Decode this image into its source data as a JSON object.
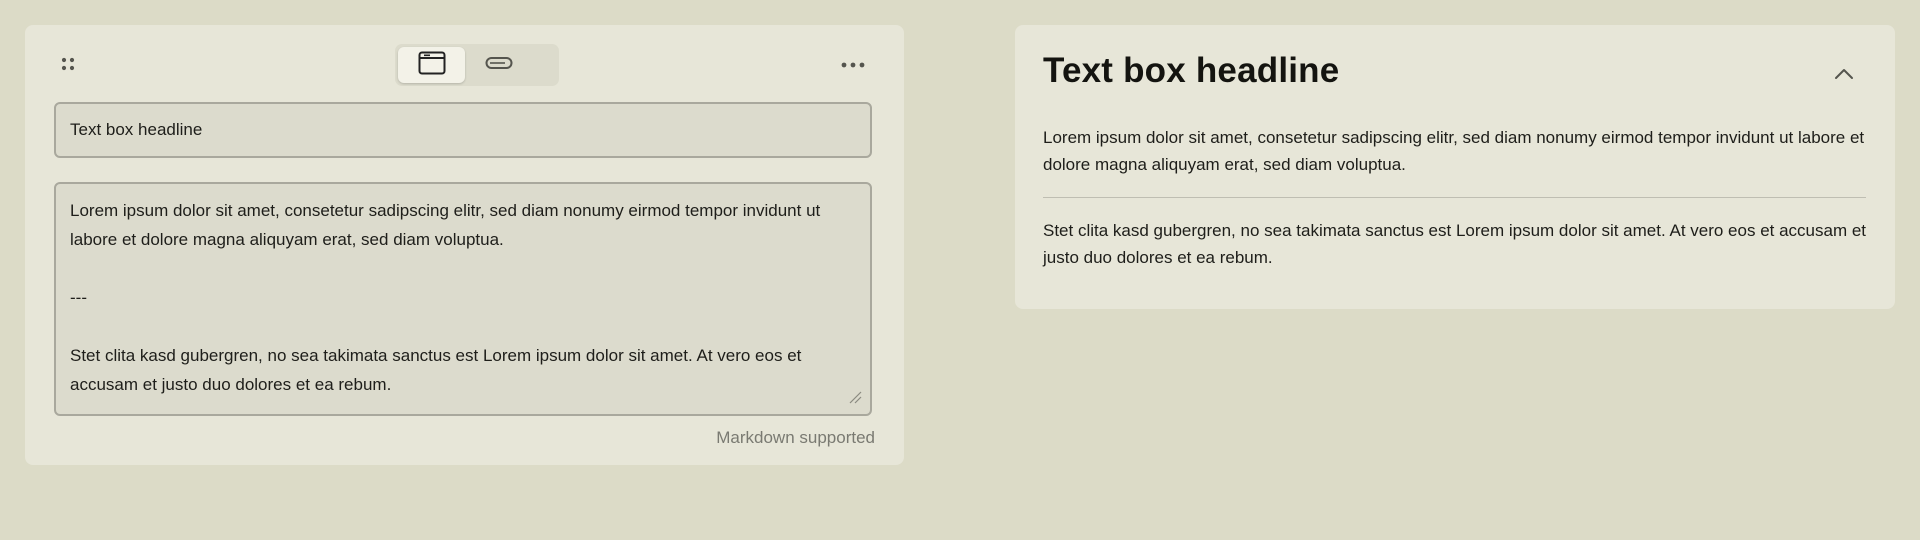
{
  "editor": {
    "toolbar": {
      "icons": {
        "drag": "drag-handle-icon",
        "card_view": "card-view-icon",
        "compact_view": "compact-view-icon",
        "more": "more-options-icon"
      }
    },
    "headline_value": "Text box headline",
    "body_value": "Lorem ipsum dolor sit amet, consetetur sadipscing elitr, sed diam nonumy eirmod tempor invidunt ut labore et dolore magna aliquyam erat, sed diam voluptua.\n\n---\n\nStet clita kasd gubergren, no sea takimata sanctus est Lorem ipsum dolor sit amet. At vero eos et accusam et justo duo dolores et ea rebum.",
    "hint": "Markdown supported"
  },
  "preview": {
    "title": "Text box headline",
    "paragraphs": [
      "Lorem ipsum dolor sit amet, consetetur sadipscing elitr, sed diam nonumy eirmod tempor invidunt ut labore et dolore magna aliquyam erat, sed diam voluptua.",
      "Stet clita kasd gubergren, no sea takimata sanctus est Lorem ipsum dolor sit amet. At vero eos et accusam et justo duo dolores et ea rebum."
    ],
    "icons": {
      "collapse": "chevron-up-icon"
    }
  },
  "colors": {
    "background": "#dcdbc7",
    "panel": "#e7e6d8",
    "input_bg": "#dcdbcd",
    "input_border": "#a9a89d",
    "hint_text": "#7a7a72"
  }
}
